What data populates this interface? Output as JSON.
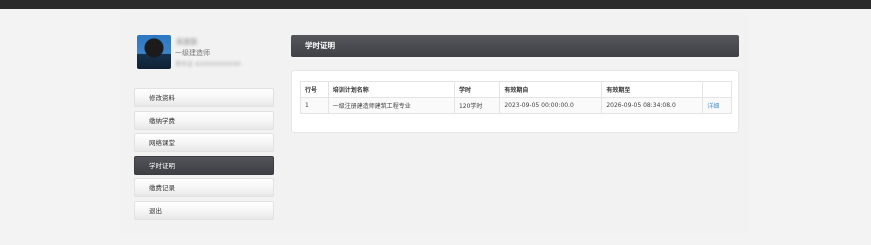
{
  "profile": {
    "name": "吴建国",
    "title": "一级建造师",
    "id": "身份证 420000000000"
  },
  "menu": {
    "items": [
      {
        "label": "修改资料"
      },
      {
        "label": "缴纳学费"
      },
      {
        "label": "网络课堂"
      },
      {
        "label": "学时证明"
      },
      {
        "label": "缴费记录"
      },
      {
        "label": "退出"
      }
    ]
  },
  "panel": {
    "title": "学时证明"
  },
  "table": {
    "headers": [
      "行号",
      "培训计划名称",
      "学时",
      "有效期自",
      "有效期至",
      ""
    ],
    "rows": [
      {
        "no": "1",
        "plan": "一级注册建造师建筑工程专业",
        "hours": "120学时",
        "from": "2023-09-05 00:00:00.0",
        "to": "2026-09-05 08:34:08.0",
        "action": "详细"
      }
    ]
  }
}
